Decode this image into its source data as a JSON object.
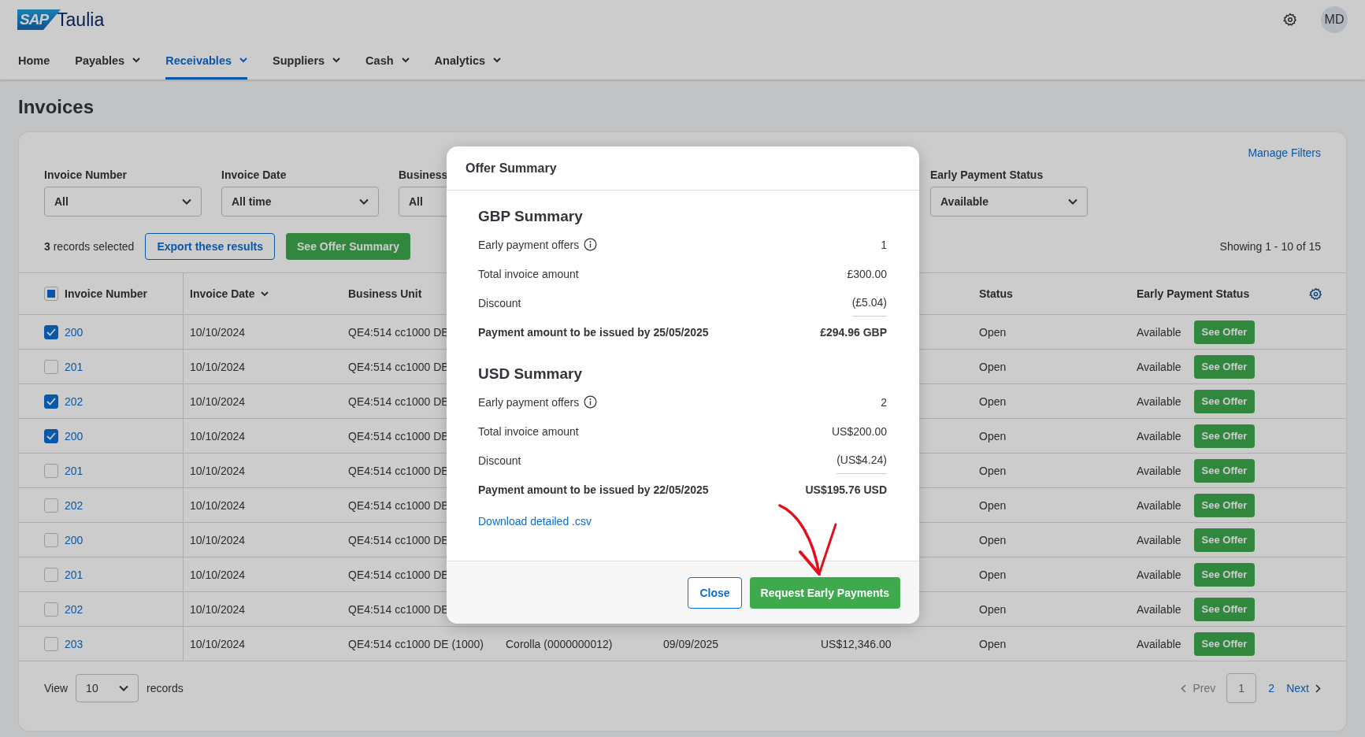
{
  "app": {
    "logo_mark": "SAP",
    "logo_name": "Taulia",
    "avatar": "MD"
  },
  "nav": [
    {
      "label": "Home",
      "selected": false,
      "has_menu": false
    },
    {
      "label": "Payables",
      "selected": false,
      "has_menu": true
    },
    {
      "label": "Receivables",
      "selected": true,
      "has_menu": true
    },
    {
      "label": "Suppliers",
      "selected": false,
      "has_menu": true
    },
    {
      "label": "Cash",
      "selected": false,
      "has_menu": true
    },
    {
      "label": "Analytics",
      "selected": false,
      "has_menu": true
    }
  ],
  "page_title": "Invoices",
  "manage_filters": "Manage Filters",
  "filters": [
    {
      "label": "Invoice Number",
      "value": "All",
      "has_caret": true
    },
    {
      "label": "Invoice Date",
      "value": "All time",
      "has_caret": true
    },
    {
      "label": "Business",
      "value": "All"
    },
    {
      "label": "Early Payment Status",
      "value": "Available",
      "has_caret": true
    }
  ],
  "selection": {
    "text": "**3** records selected",
    "export": "Export these results",
    "summary": "See Offer Summary",
    "showing": "Showing 1 - 10 of 15"
  },
  "table": {
    "select_all": {
      "indeterminate": true
    },
    "header": {
      "invoice_number": "Invoice Number",
      "invoice_date": "Invoice Date",
      "invoice_date_sorted": true,
      "business_unit": "Business Unit",
      "status": "Status",
      "early_payment_status": "Early Payment Status"
    },
    "rows": [
      {
        "invoice_number": "200",
        "checked": true,
        "invoice_date": "10/10/2024",
        "business_unit": "QE4:514 cc1000 DE",
        "status": "Open",
        "early_payment_status": "Available",
        "action": "See Offer"
      },
      {
        "invoice_number": "201",
        "checked": false,
        "invoice_date": "10/10/2024",
        "business_unit": "QE4:514 cc1000 DE",
        "status": "Open",
        "early_payment_status": "Available",
        "action": "See Offer"
      },
      {
        "invoice_number": "202",
        "checked": true,
        "invoice_date": "10/10/2024",
        "business_unit": "QE4:514 cc1000 DE",
        "status": "Open",
        "early_payment_status": "Available",
        "action": "See Offer"
      },
      {
        "invoice_number": "200",
        "checked": true,
        "invoice_date": "10/10/2024",
        "business_unit": "QE4:514 cc1000 DE",
        "status": "Open",
        "early_payment_status": "Available",
        "action": "See Offer"
      },
      {
        "invoice_number": "201",
        "checked": false,
        "invoice_date": "10/10/2024",
        "business_unit": "QE4:514 cc1000 DE",
        "status": "Open",
        "early_payment_status": "Available",
        "action": "See Offer"
      },
      {
        "invoice_number": "202",
        "checked": false,
        "invoice_date": "10/10/2024",
        "business_unit": "QE4:514 cc1000 DE",
        "status": "Open",
        "early_payment_status": "Available",
        "action": "See Offer"
      },
      {
        "invoice_number": "200",
        "checked": false,
        "invoice_date": "10/10/2024",
        "business_unit": "QE4:514 cc1000 DE",
        "status": "Open",
        "early_payment_status": "Available",
        "action": "See Offer"
      },
      {
        "invoice_number": "201",
        "checked": false,
        "invoice_date": "10/10/2024",
        "business_unit": "QE4:514 cc1000 DE",
        "status": "Open",
        "early_payment_status": "Available",
        "action": "See Offer"
      },
      {
        "invoice_number": "202",
        "checked": false,
        "invoice_date": "10/10/2024",
        "business_unit": "QE4:514 cc1000 DE",
        "status": "Open",
        "early_payment_status": "Available",
        "action": "See Offer"
      },
      {
        "invoice_number": "203",
        "checked": false,
        "invoice_date": "10/10/2024",
        "business_unit": "QE4:514 cc1000 DE (1000)",
        "column_4": "Corolla (0000000012)",
        "column_5": "09/09/2025",
        "column_6": "US$12,346.00",
        "status": "Open",
        "early_payment_status": "Available",
        "action": "See Offer"
      }
    ]
  },
  "footer": {
    "view_label": "View",
    "view_value": "10",
    "view_suffix": "records",
    "prev": "Prev",
    "prev_disabled": true,
    "pages": [
      {
        "label": "1",
        "selected": true
      },
      {
        "label": "2",
        "selected": false
      }
    ],
    "next": "Next"
  },
  "modal": {
    "title": "Offer Summary",
    "sections": [
      {
        "heading": "GBP Summary",
        "rows": [
          {
            "kind": "info",
            "label": "Early payment offers",
            "value": "1"
          },
          {
            "kind": "plain",
            "label": "Total invoice amount",
            "value": "£300.00"
          },
          {
            "kind": "discount",
            "label": "Discount",
            "value": "(£5.04)"
          },
          {
            "kind": "total",
            "label": "Payment amount to be issued by 25/05/2025",
            "value": "£294.96 GBP"
          }
        ]
      },
      {
        "heading": "USD Summary",
        "rows": [
          {
            "kind": "info",
            "label": "Early payment offers",
            "value": "2"
          },
          {
            "kind": "plain",
            "label": "Total invoice amount",
            "value": "US$200.00"
          },
          {
            "kind": "discount",
            "label": "Discount",
            "value": "(US$4.24)"
          },
          {
            "kind": "total",
            "label": "Payment amount to be issued by 22/05/2025",
            "value": "US$195.76 USD"
          }
        ]
      }
    ],
    "download": "Download detailed .csv",
    "close": "Close",
    "request": "Request Early Payments"
  }
}
